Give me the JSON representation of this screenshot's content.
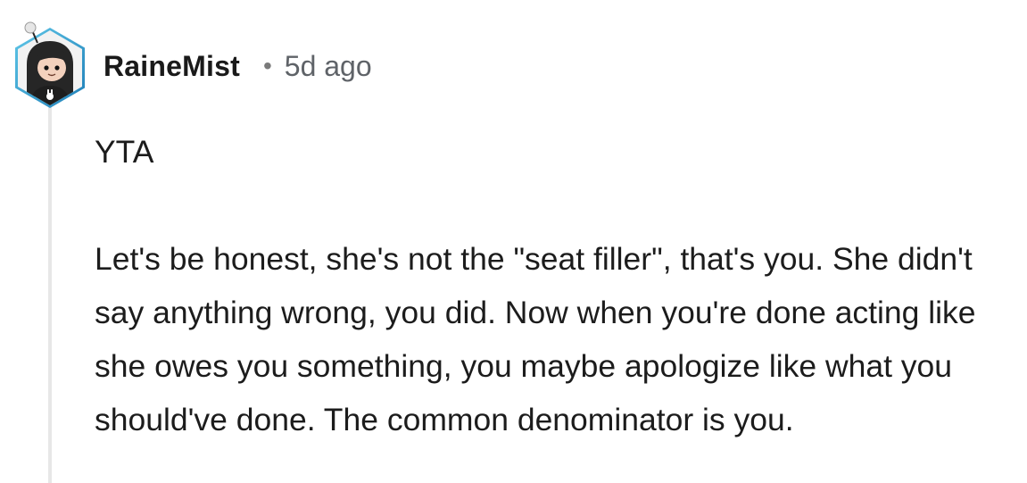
{
  "comment": {
    "username": "RaineMist",
    "separator": "•",
    "timestamp": "5d ago",
    "verdict": "YTA",
    "paragraph": "Let's be honest, she's not the \"seat filler\", that's you. She didn't say anything wrong, you did. Now when you're done acting like she owes you something, you maybe apologize like what you should've done. The common denominator is you."
  },
  "colors": {
    "avatar_border": "#3aa7d6",
    "avatar_bg": "#f2f2f2",
    "thread_line": "#e7e7e7",
    "text": "#1c1c1c",
    "meta": "#5f6368"
  },
  "icons": {
    "avatar": "snoo-avatar-icon"
  }
}
